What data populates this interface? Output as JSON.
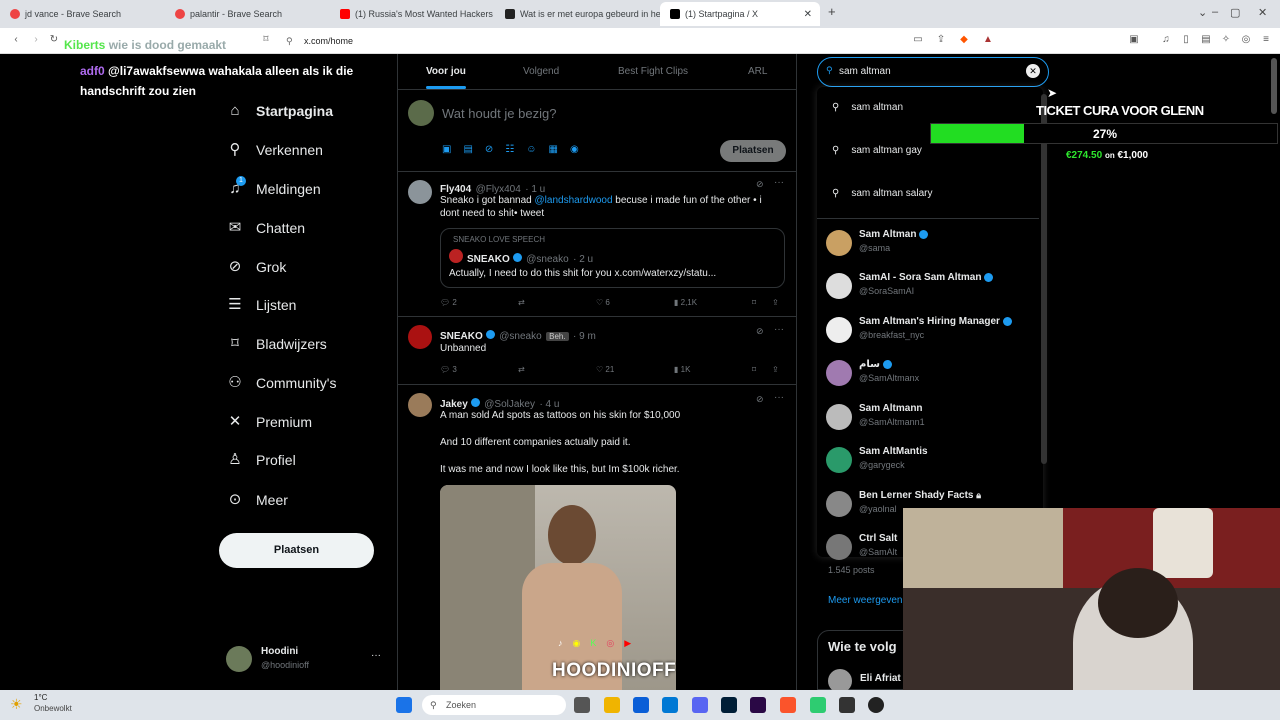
{
  "browser": {
    "tabs": [
      {
        "label": "jd vance - Brave Search",
        "color": "#e44"
      },
      {
        "label": "palantir - Brave Search",
        "color": "#e44"
      },
      {
        "label": "(1) Russia's Most Wanted Hackers - Y",
        "color": "#f00"
      },
      {
        "label": "Wat is er met europa gebeurd in hel",
        "color": "#222"
      },
      {
        "label": "(1) Startpagina / X",
        "color": "#000"
      }
    ],
    "url": "x.com/home",
    "new_tab": "+"
  },
  "chat_overlay": {
    "lines": [
      {
        "user": "Kiberts",
        "text": "wie is dood gemaakt"
      },
      {
        "user": "adf0",
        "text": "@li7awakfsewwa wahakala alleen als ik die handschrift zou zien"
      }
    ]
  },
  "nav": {
    "items": [
      "Startpagina",
      "Verkennen",
      "Meldingen",
      "Chatten",
      "Grok",
      "Lijsten",
      "Bladwijzers",
      "Community's",
      "Premium",
      "Profiel",
      "Meer"
    ],
    "post_button": "Plaatsen",
    "notif_count": "1",
    "account": {
      "name": "Hoodini",
      "handle": "@hoodinioff"
    }
  },
  "feed": {
    "tabs": [
      "Voor jou",
      "Volgend",
      "Best Fight Clips",
      "ARL"
    ],
    "compose_placeholder": "Wat houdt je bezig?",
    "compose_button": "Plaatsen",
    "tweets": [
      {
        "name": "Fly404",
        "handle": "@Flyx404",
        "time": "· 1 u",
        "text1": "Sneako i got bannad",
        "mention": "@landshardwood",
        "text2": "becuse i made fun of the other • i dont need to shit• tweet",
        "quote": {
          "label": "SNEAKO LOVE SPEECH",
          "name": "SNEAKO",
          "handle": "@sneako",
          "time": "· 2 u",
          "text": "Actually, I need to do this shit for you x.com/waterxzy/statu..."
        },
        "replies": "2",
        "likes": "6",
        "views": "2,1K"
      },
      {
        "name": "SNEAKO",
        "handle": "@sneako",
        "badge": "Beh.",
        "time": "· 9 m",
        "text": "Unbanned",
        "replies": "3",
        "likes": "21",
        "views": "1K"
      },
      {
        "name": "Jakey",
        "handle": "@SolJakey",
        "time": "· 4 u",
        "lines": [
          "A man sold Ad spots as tattoos on his skin for $10,000",
          "And 10 different companies actually paid it.",
          "It was me and now I look like this, but Im $100k richer."
        ]
      }
    ]
  },
  "search": {
    "value": "sam altman",
    "suggestions": [
      "sam altman",
      "sam altman gay",
      "sam altman salary"
    ],
    "users": [
      {
        "name": "Sam Altman",
        "handle": "@sama",
        "color": "#c9a063"
      },
      {
        "name": "SamAI - Sora Sam Altman",
        "handle": "@SoraSamAI",
        "color": "#ddd"
      },
      {
        "name": "Sam Altman's Hiring Manager",
        "handle": "@breakfast_nyc",
        "color": "#eee"
      },
      {
        "name": "سام",
        "handle": "@SamAltmanx",
        "color": "#a07ab0"
      },
      {
        "name": "Sam Altmann",
        "handle": "@SamAltmann1",
        "color": "#bbb"
      },
      {
        "name": "Sam AltMantis",
        "handle": "@garygeck",
        "color": "#2a9a6a"
      },
      {
        "name": "Ben Lerner Shady Facts",
        "handle": "@yaolnal",
        "color": "#888"
      },
      {
        "name": "Ctrl Salt",
        "handle": "@SamAlt",
        "color": "#777"
      }
    ],
    "posts_count": "1.545 posts",
    "show_more": "Meer weergeven",
    "who_to_follow": "Wie te volg",
    "follow_user": "Eli Afriat"
  },
  "stream_overlay": {
    "goal_title": "TICKET CURA VOOR GLENN",
    "goal_percent": "27%",
    "goal_progress": 0.27,
    "goal_raised": "€274.50",
    "goal_sep": "on",
    "goal_target": "€1,000",
    "brand": "HOODINIOFF"
  },
  "taskbar": {
    "weather_temp": "1°C",
    "weather_desc": "Onbewolkt",
    "search": "Zoeken"
  }
}
